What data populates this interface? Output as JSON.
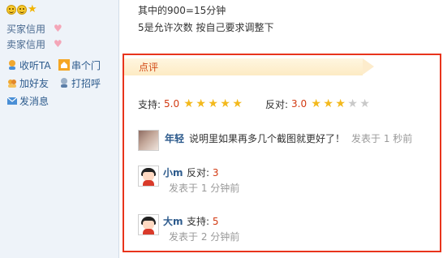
{
  "sidebar": {
    "buy_credit": "买家信用",
    "sell_credit": "卖家信用",
    "actions": [
      {
        "label": "收听TA",
        "icon": "listen-icon"
      },
      {
        "label": "串个门",
        "icon": "home-icon"
      },
      {
        "label": "加好友",
        "icon": "add-friend-icon"
      },
      {
        "label": "打招呼",
        "icon": "greet-icon"
      },
      {
        "label": "发消息",
        "icon": "mail-icon"
      }
    ]
  },
  "content": {
    "line1": "其中的900=15分钟",
    "line2": "5是允许次数 按自己要求调整下"
  },
  "review": {
    "title": "点评",
    "support_label": "支持:",
    "support_score": "5.0",
    "support_stars": 5,
    "oppose_label": "反对:",
    "oppose_score": "3.0",
    "oppose_stars": 3,
    "comments": [
      {
        "user": "年轻",
        "text": "说明里如果再多几个截图就更好了！",
        "time": "发表于 1 秒前"
      },
      {
        "user": "小m",
        "action_label": "反对:",
        "action_value": "3",
        "time": "发表于 1 分钟前"
      },
      {
        "user": "大m",
        "action_label": "支持:",
        "action_value": "5",
        "time": "发表于 2 分钟前"
      }
    ]
  },
  "colors": {
    "accent_red": "#e8341c",
    "score_red": "#d23a12",
    "link_blue": "#2c5a8c",
    "star_gold": "#f3b91c"
  }
}
